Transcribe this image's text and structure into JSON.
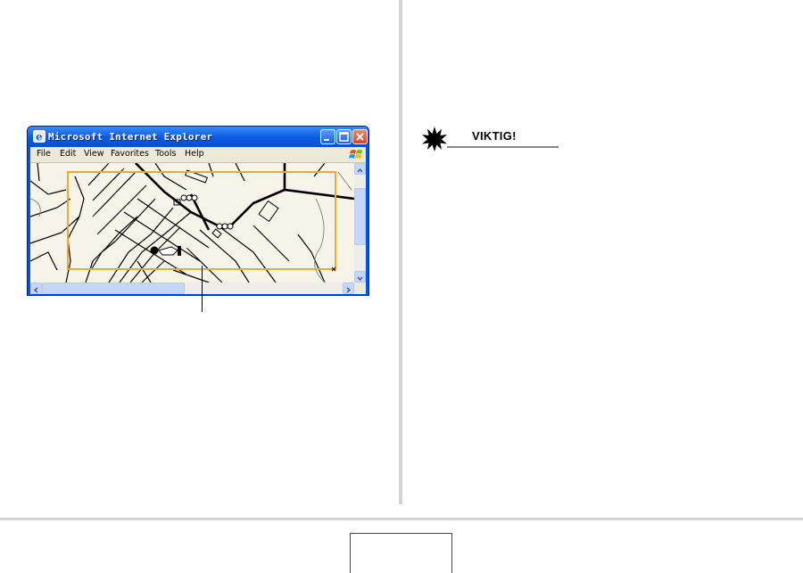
{
  "browser": {
    "title": "Microsoft Internet Explorer",
    "menu": [
      "File",
      "Edit",
      "View",
      "Favorites",
      "Tools",
      "Help"
    ],
    "selection_color": "#f0a830"
  },
  "important": {
    "label": "VIKTIG!",
    "icon": "starburst-icon"
  },
  "colors": {
    "title_bar": "#0a5ae0",
    "divider": "#d4d4d4",
    "map_background": "#f6f3e8"
  }
}
